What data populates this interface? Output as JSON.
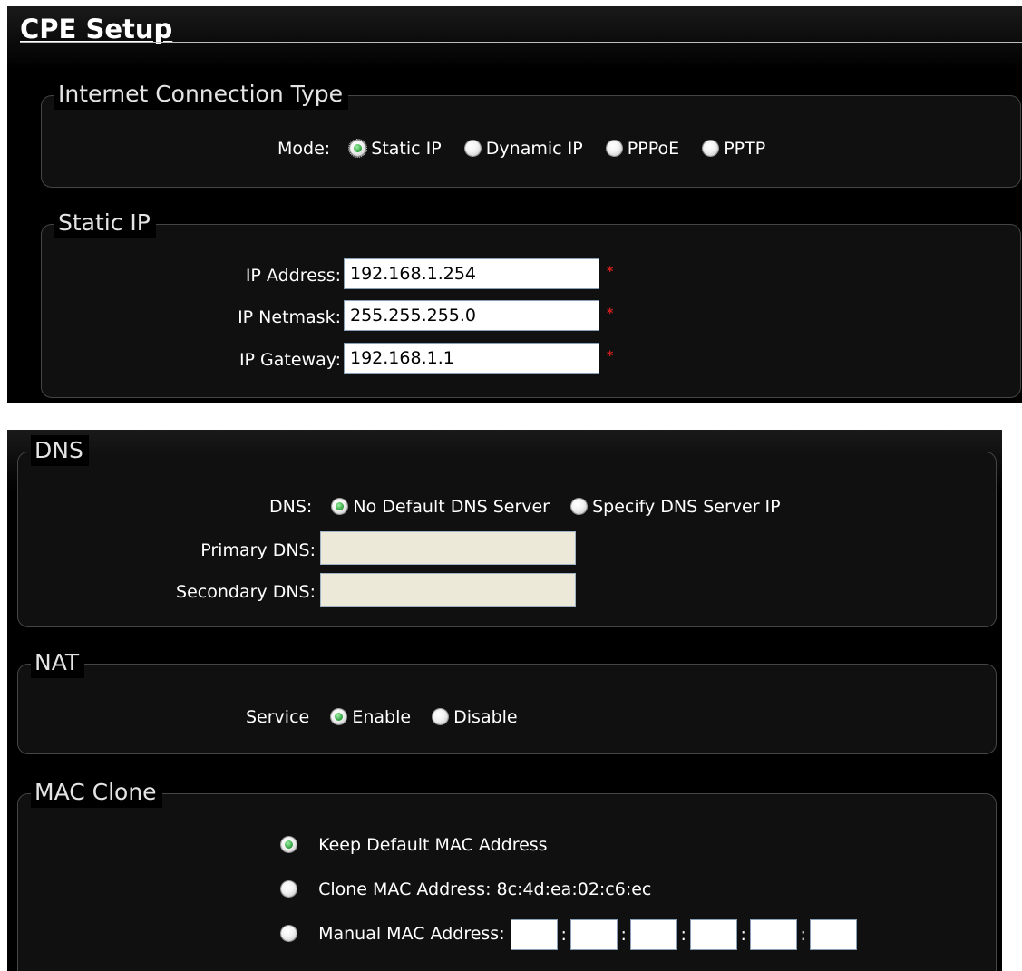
{
  "page": {
    "title": "CPE Setup"
  },
  "connection_type": {
    "legend": "Internet Connection Type",
    "mode_label": "Mode:",
    "options": [
      "Static IP",
      "Dynamic IP",
      "PPPoE",
      "PPTP"
    ],
    "selected": "Static IP"
  },
  "static_ip": {
    "legend": "Static IP",
    "ip_address_label": "IP Address:",
    "ip_address_value": "192.168.1.254",
    "netmask_label": "IP Netmask:",
    "netmask_value": "255.255.255.0",
    "gateway_label": "IP Gateway:",
    "gateway_value": "192.168.1.1",
    "required_mark": "*"
  },
  "dns": {
    "legend": "DNS",
    "dns_label": "DNS:",
    "options": [
      "No Default DNS Server",
      "Specify DNS Server IP"
    ],
    "selected": "No Default DNS Server",
    "primary_label": "Primary DNS:",
    "primary_value": "",
    "secondary_label": "Secondary DNS:",
    "secondary_value": ""
  },
  "nat": {
    "legend": "NAT",
    "service_label": "Service",
    "options": [
      "Enable",
      "Disable"
    ],
    "selected": "Enable"
  },
  "mac_clone": {
    "legend": "MAC Clone",
    "keep_default_label": "Keep Default MAC Address",
    "clone_label": "Clone MAC Address: 8c:4d:ea:02:c6:ec",
    "manual_label": "Manual MAC Address:",
    "selected": "Keep Default MAC Address",
    "manual_octets": [
      "",
      "",
      "",
      "",
      "",
      ""
    ],
    "separator": ":"
  },
  "colors": {
    "background": "#000000",
    "selected_radio": "#2f9c3b",
    "required": "#d62020",
    "disabled_input": "#ece9d8"
  }
}
